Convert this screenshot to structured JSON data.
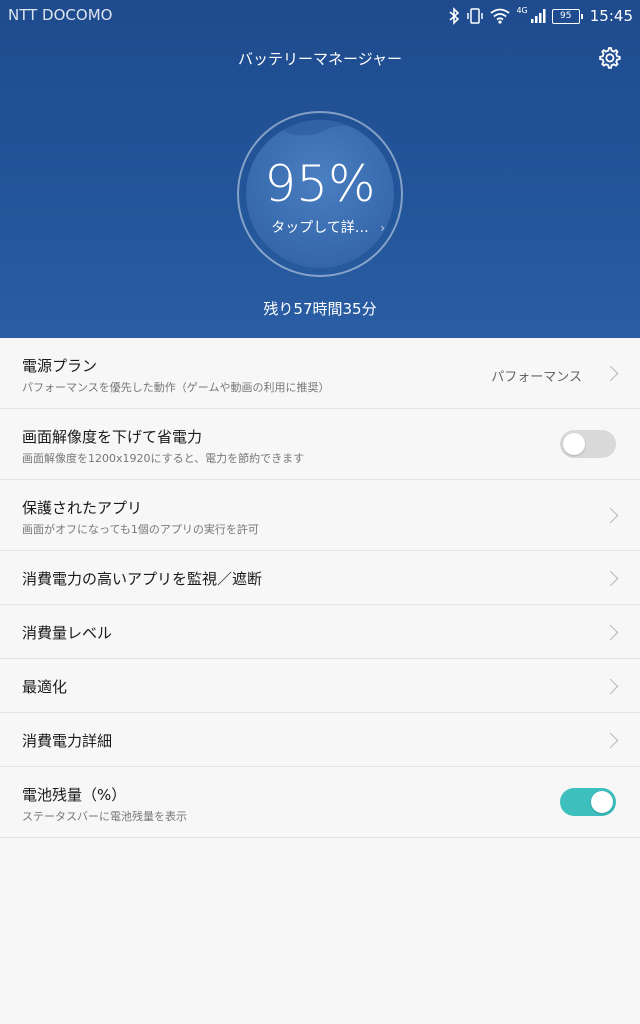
{
  "status_bar": {
    "carrier": "NTT DOCOMO",
    "network": "4G",
    "battery": "95",
    "time": "15:45"
  },
  "header": {
    "title": "バッテリーマネージャー",
    "settings_icon": "gear-icon",
    "percent": "95%",
    "tap_detail": "タップして詳…",
    "remaining": "残り57時間35分"
  },
  "rows": [
    {
      "title": "電源プラン",
      "subtitle": "パフォーマンスを優先した動作（ゲームや動画の利用に推奨）",
      "value": "パフォーマンス",
      "control": "chevron"
    },
    {
      "title": "画面解像度を下げて省電力",
      "subtitle": "画面解像度を1200x1920にすると、電力を節約できます",
      "control": "toggle",
      "on": false
    },
    {
      "title": "保護されたアプリ",
      "subtitle": "画面がオフになっても1個のアプリの実行を許可",
      "control": "chevron"
    },
    {
      "title": "消費電力の高いアプリを監視／遮断",
      "control": "chevron"
    },
    {
      "title": "消費量レベル",
      "control": "chevron"
    },
    {
      "title": "最適化",
      "control": "chevron"
    },
    {
      "title": "消費電力詳細",
      "control": "chevron"
    },
    {
      "title": "電池残量（%）",
      "subtitle": "ステータスバーに電池残量を表示",
      "control": "toggle",
      "on": true
    }
  ],
  "colors": {
    "header_bg": "#23559a",
    "toggle_on": "#3cbfbd",
    "toggle_off": "#d9d9d9"
  }
}
